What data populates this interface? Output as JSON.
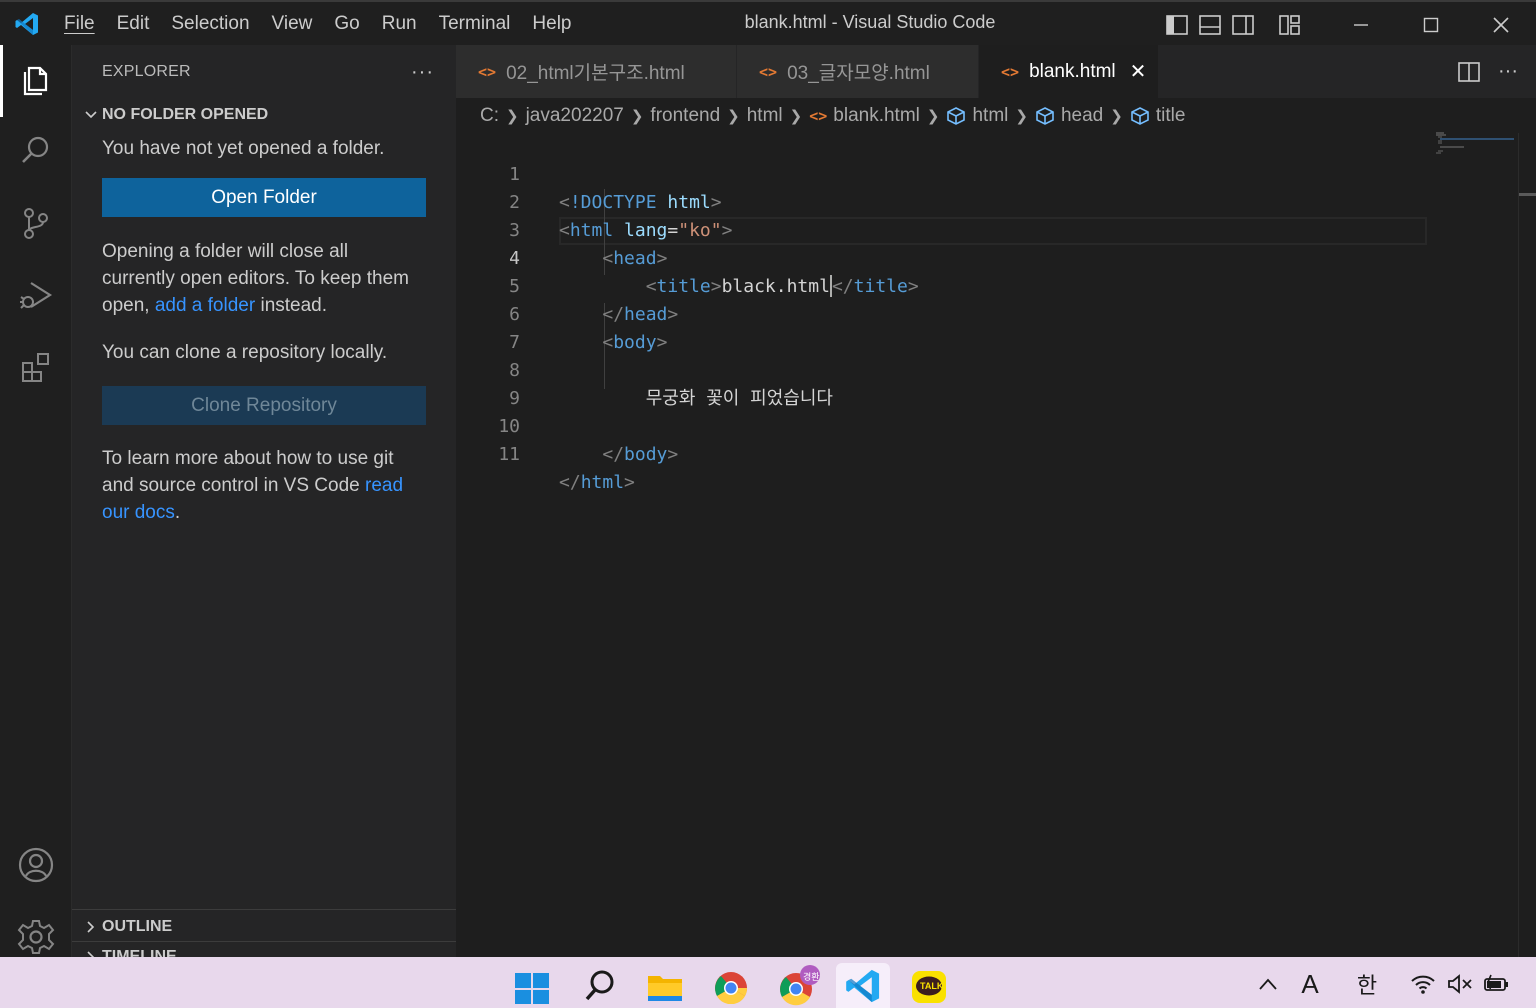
{
  "window": {
    "title": "blank.html - Visual Studio Code",
    "menu": [
      "File",
      "Edit",
      "Selection",
      "View",
      "Go",
      "Run",
      "Terminal",
      "Help"
    ]
  },
  "activity_bar": {
    "items": [
      "files-icon",
      "search-icon",
      "source-control-icon",
      "run-debug-icon",
      "extensions-icon"
    ],
    "bottom": [
      "account-icon",
      "manage-gear-icon"
    ]
  },
  "sidebar": {
    "title": "EXPLORER",
    "more": "···",
    "section_title": "NO FOLDER OPENED",
    "no_folder_text": "You have not yet opened a folder.",
    "open_folder_button": "Open Folder",
    "opening_text_1": "Opening a folder will close all currently open editors. To keep them open, ",
    "add_folder_link": "add a folder",
    "opening_text_2": " instead.",
    "clone_text": "You can clone a repository locally.",
    "clone_button": "Clone Repository",
    "learn_text": "To learn more about how to use git and source control in VS Code ",
    "docs_link": "read our docs",
    "learn_end": ".",
    "outline": "OUTLINE",
    "timeline": "TIMELINE"
  },
  "tabs": [
    {
      "label": "02_html기본구조.html",
      "active": false
    },
    {
      "label": "03_글자모양.html",
      "active": false
    },
    {
      "label": "blank.html",
      "active": true
    }
  ],
  "tab_close": "✕",
  "breadcrumbs": [
    "C:",
    "java202207",
    "frontend",
    "html",
    "blank.html",
    "html",
    "head",
    "title"
  ],
  "editor": {
    "active_line": 4,
    "lines": [
      "1",
      "2",
      "3",
      "4",
      "5",
      "6",
      "7",
      "8",
      "9",
      "10",
      "11"
    ],
    "code": {
      "l1_doctype": "!DOCTYPE",
      "l1_html": "html",
      "l2_tag": "html",
      "l2_attr": "lang",
      "l2_val": "\"ko\"",
      "l3_tag": "head",
      "l4_tag": "title",
      "l4_text": "black.html",
      "l4_close": "title",
      "l5_tag": "head",
      "l6_tag": "body",
      "l8_text": "무궁화 꽃이 피었습니다",
      "l10_tag": "body",
      "l11_tag": "html"
    }
  },
  "taskbar": {
    "apps": [
      "start-icon",
      "search-icon",
      "file-explorer-icon",
      "chrome-icon",
      "chrome-profile-icon",
      "vscode-icon",
      "kakaotalk-icon"
    ],
    "chrome_badge": "경환",
    "kakao_label": "TALK",
    "ime_mode": "A",
    "ime_lang": "한"
  }
}
